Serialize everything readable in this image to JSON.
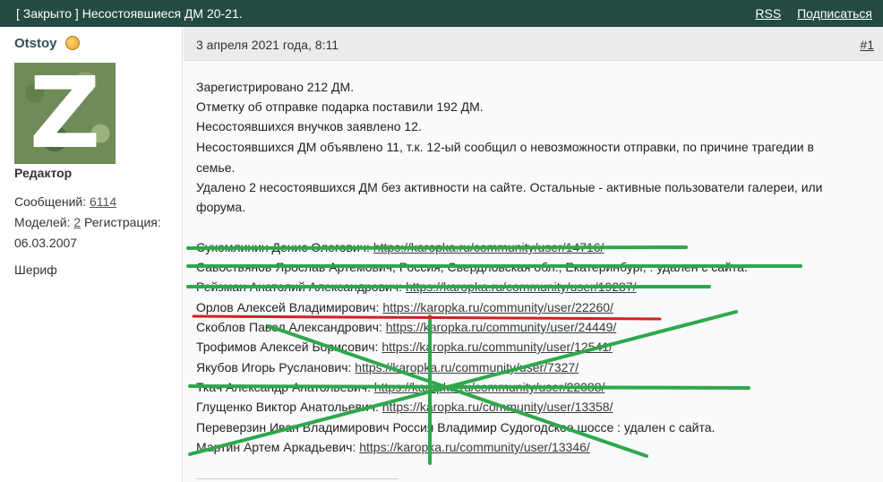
{
  "topbar": {
    "title": "[ Закрыто ] Несостоявшиеся ДМ 20-21.",
    "rss_label": "RSS",
    "subscribe_label": "Подписаться",
    "bg_color": "#244a44"
  },
  "author": {
    "name": "Otstoy",
    "role": "Редактор",
    "messages_label": "Сообщений:",
    "messages_count": "6114",
    "models_label": "Моделей:",
    "models_count": "2",
    "registration_label": "Регистрация:",
    "registration_date": "06.03.2007",
    "rank": "Шериф",
    "avatar_letter": "Z"
  },
  "post": {
    "date": "3 апреля 2021 года, 8:11",
    "number": "#1",
    "paragraphs": [
      "Зарегистрировано 212 ДМ.",
      "Отметку об отправке подарка поставили 192 ДМ.",
      "Несостоявшихся внучков заявлено 12.",
      "Несостоявшихся ДМ объявлено 11, т.к. 12-ый сообщил о невозможности отправки, по причине трагедии в",
      "семье.",
      "Удалено 2 несостоявшихся ДМ без активности на сайте. Остальные - активные пользователи галереи, или",
      "форума."
    ],
    "list": [
      {
        "name": "Сухомлинин Денис Олегович:",
        "link": "https://karopka.ru/community/user/14716/",
        "suffix": ""
      },
      {
        "name": "Савостьянов Ярослав Артемович, Россия, Свердловская обл., Екатеринбург, : удален с сайта.",
        "link": "",
        "suffix": ""
      },
      {
        "name": "Рейзман Анатолий Александрович:",
        "link": "https://karopka.ru/community/user/19287/",
        "suffix": ""
      },
      {
        "name": "Орлов Алексей Владимирович:",
        "link": "https://karopka.ru/community/user/22260/",
        "suffix": ""
      },
      {
        "name": "Скоблов Павел Александрович:",
        "link": "https://karopka.ru/community/user/24449/",
        "suffix": ""
      },
      {
        "name": "Трофимов Алексей Борисович:",
        "link": "https://karopka.ru/community/user/12541/",
        "suffix": ""
      },
      {
        "name": "Якубов Игорь Русланович:",
        "link": "https://karopka.ru/community/user/7327/",
        "suffix": ""
      },
      {
        "name": "Ткач Александр Анатольевич:",
        "link": "https://karopka.ru/community/user/22088/",
        "suffix": ""
      },
      {
        "name": "Глущенко Виктор Анатольевич:",
        "link": "https://karopka.ru/community/user/13358/",
        "suffix": ""
      },
      {
        "name": "Переверзин Иван Владимирович Россия Владимир Судогодское шоссе : удален с сайта.",
        "link": "",
        "suffix": ""
      },
      {
        "name": "Мартин Артем Аркадьевич:",
        "link": "https://karopka.ru/community/user/13346/",
        "suffix": ""
      }
    ]
  },
  "annotations": {
    "strike_color": "#2ea84a",
    "underline_color": "#d32020"
  }
}
